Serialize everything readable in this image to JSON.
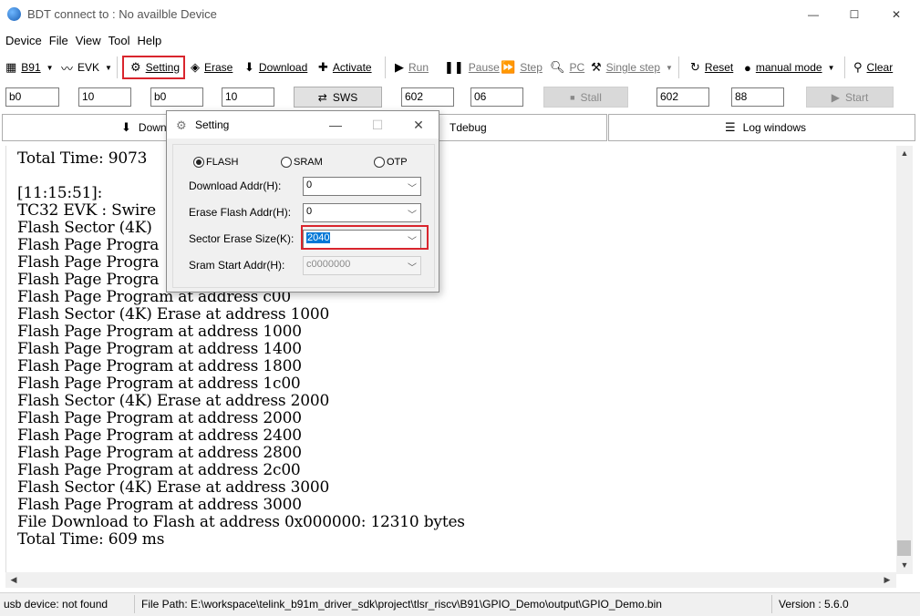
{
  "window": {
    "title": "BDT connect to : No availble Device",
    "min": "—",
    "max": "☐",
    "close": "✕"
  },
  "menu": [
    "Device",
    "File",
    "View",
    "Tool",
    "Help"
  ],
  "toolbar": {
    "chip": "B91",
    "board": "EVK",
    "setting": "Setting",
    "erase": "Erase",
    "download": "Download",
    "activate": "Activate",
    "run": "Run",
    "pause": "Pause",
    "step": "Step",
    "pc": "PC",
    "single_step": "Single step",
    "reset": "Reset",
    "manual_mode": "manual mode",
    "clear": "Clear"
  },
  "fields": {
    "f1": "b0",
    "f2": "10",
    "f3": "b0",
    "f4": "10",
    "sws": "SWS",
    "f5": "602",
    "f6": "06",
    "stall": "Stall",
    "f7": "602",
    "f8": "88",
    "start": "Start"
  },
  "tabs": {
    "download": "Downl",
    "tdebug": "Tdebug",
    "log": "Log windows"
  },
  "log_lines": [
    "Total Time: 9073",
    "",
    "[11:15:51]:",
    "TC32 EVK : Swire",
    "Flash Sector (4K)",
    "Flash Page Progra",
    "Flash Page Progra",
    "Flash Page Progra",
    "Flash Page Program at address c00",
    "Flash Sector (4K) Erase at address 1000",
    "Flash Page Program at address 1000",
    "Flash Page Program at address 1400",
    "Flash Page Program at address 1800",
    "Flash Page Program at address 1c00",
    "Flash Sector (4K) Erase at address 2000",
    "Flash Page Program at address 2000",
    "Flash Page Program at address 2400",
    "Flash Page Program at address 2800",
    "Flash Page Program at address 2c00",
    "Flash Sector (4K) Erase at address 3000",
    "Flash Page Program at address 3000",
    "File Download to Flash at address 0x000000: 12310 bytes",
    "Total Time: 609 ms"
  ],
  "status": {
    "usb": "usb device: not found",
    "file_path": "File Path:  E:\\workspace\\telink_b91m_driver_sdk\\project\\tlsr_riscv\\B91\\GPIO_Demo\\output\\GPIO_Demo.bin",
    "version": "Version : 5.6.0"
  },
  "dialog": {
    "title": "Setting",
    "radios": [
      "FLASH",
      "SRAM",
      "OTP"
    ],
    "selected_radio": "FLASH",
    "download_label": "Download  Addr(H):",
    "download_value": "0",
    "erase_label": "Erase Flash Addr(H):",
    "erase_value": "0",
    "sector_label": "Sector Erase Size(K):",
    "sector_value": "2040",
    "sram_label": "Sram Start Addr(H):",
    "sram_value": "c0000000"
  },
  "colors": {
    "highlight_box": "#d9252d",
    "selection": "#0078d7"
  }
}
